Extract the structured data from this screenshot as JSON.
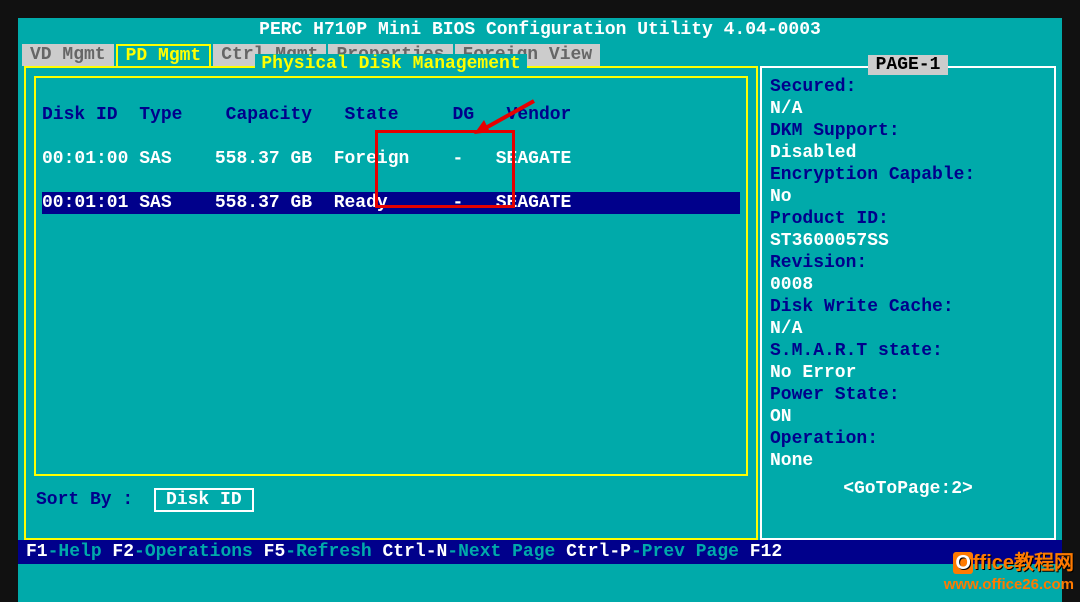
{
  "title": "PERC H710P Mini BIOS Configuration Utility 4.04-0003",
  "menu": {
    "vd": "VD Mgmt",
    "pd": "PD Mgmt",
    "ctrl": "Ctrl Mgmt",
    "props": "Properties",
    "foreign": "Foreign View"
  },
  "panel_title": "Physical Disk Management",
  "table": {
    "headers": {
      "diskid": "Disk ID",
      "type": "Type",
      "capacity": "Capacity",
      "state": "State",
      "dg": "DG",
      "vendor": "Vendor"
    },
    "rows": [
      {
        "diskid": "00:01:00",
        "type": "SAS",
        "capacity": "558.37 GB",
        "state": "Foreign",
        "dg": "-",
        "vendor": "SEAGATE"
      },
      {
        "diskid": "00:01:01",
        "type": "SAS",
        "capacity": "558.37 GB",
        "state": "Ready",
        "dg": "-",
        "vendor": "SEAGATE"
      }
    ]
  },
  "sortby_label": "Sort By :",
  "sortby_value": "Disk ID",
  "right": {
    "page_label": "PAGE-1",
    "secured_l": "Secured:",
    "secured_v": "N/A",
    "dkm_l": "DKM Support:",
    "dkm_v": "Disabled",
    "enc_l": "Encryption Capable:",
    "enc_v": "No",
    "prod_l": "Product ID:",
    "prod_v": "ST3600057SS",
    "rev_l": "Revision:",
    "rev_v": "0008",
    "dwc_l": "Disk Write Cache:",
    "dwc_v": "N/A",
    "smart_l": "S.M.A.R.T state:",
    "smart_v": "No Error",
    "power_l": "Power State:",
    "power_v": "ON",
    "op_l": "Operation:",
    "op_v": "None",
    "goto": "<GoToPage:2>"
  },
  "help": {
    "f1k": "F1",
    "f1t": "-Help ",
    "f2k": "F2",
    "f2t": "-Operations ",
    "f5k": "F5",
    "f5t": "-Refresh ",
    "cnk": "Ctrl-N",
    "cnt": "-Next Page ",
    "cpk": "Ctrl-P",
    "cpt": "-Prev Page ",
    "f12k": "F12"
  },
  "watermark": {
    "line1": "ffice教程网",
    "line2": "www.office26.com"
  }
}
